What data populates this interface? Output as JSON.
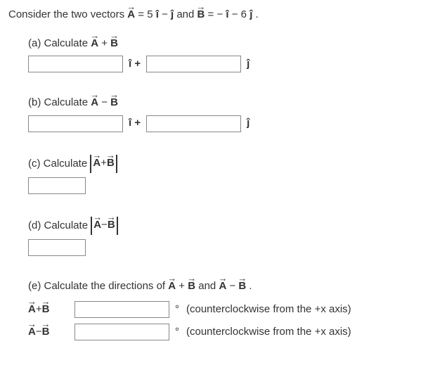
{
  "statement": {
    "prefix": "Consider the two vectors ",
    "A_eq": " = 5 ",
    "minus1": " − ",
    "and": " and ",
    "B_eq": " = − ",
    "minus2": " − 6 ",
    "period": "."
  },
  "vectors": {
    "A": "A",
    "B": "B",
    "i": "î",
    "j": "ĵ"
  },
  "parts": {
    "a": {
      "label": "(a) Calculate ",
      "op": " + "
    },
    "b": {
      "label": "(b) Calculate ",
      "op": " − "
    },
    "c": {
      "label": "(c) Calculate ",
      "op": " + "
    },
    "d": {
      "label": "(d) Calculate ",
      "op": " − "
    },
    "e": {
      "label_prefix": "(e) Calculate the directions of ",
      "and": " and ",
      "period": ".",
      "rowA_op": " + ",
      "rowB_op": " − ",
      "deg": "°",
      "ccw": " (counterclockwise from the +x axis)"
    }
  },
  "units": {
    "i_between": "î +",
    "j_after": "ĵ"
  }
}
